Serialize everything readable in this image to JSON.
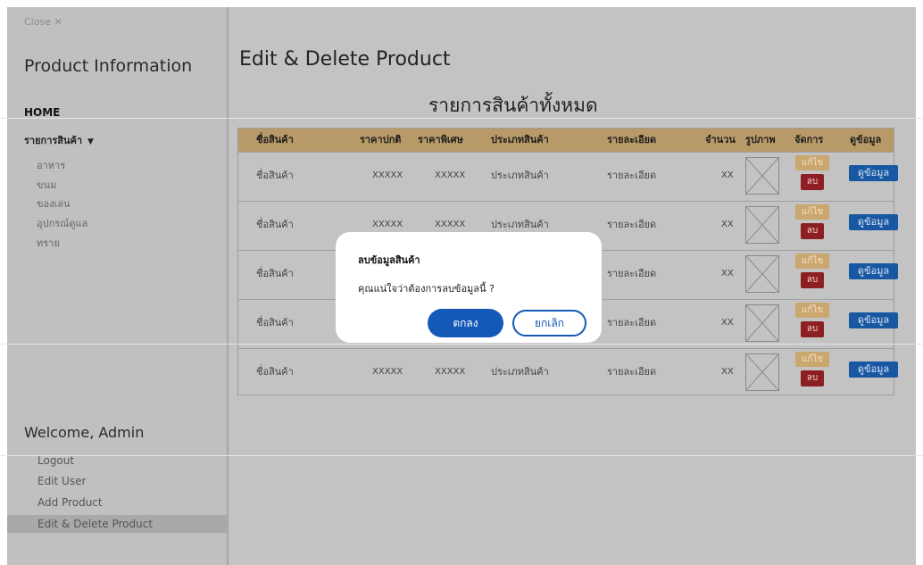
{
  "sidebar": {
    "close_label": "Close ✕",
    "title": "Product Information",
    "home_label": "HOME",
    "category_menu_label": "รายการสินค้า",
    "category_items": [
      "อาหาร",
      "ขนม",
      "ของเล่น",
      "อุปกรณ์ดูแล",
      "ทราย"
    ],
    "welcome": "Welcome, Admin",
    "bottom_items": [
      "Logout",
      "Edit User",
      "Add Product",
      "Edit & Delete Product"
    ],
    "active_item": "Edit & Delete Product"
  },
  "main": {
    "page_title": "Edit & Delete Product",
    "list_title": "รายการสินค้าทั้งหมด"
  },
  "table": {
    "headers": {
      "name": "ชื่อสินค้า",
      "price": "ราคาปกติ",
      "special": "ราคาพิเศษ",
      "type": "ประเภทสินค้า",
      "detail": "รายละเอียด",
      "qty": "จำนวน",
      "image": "รูปภาพ",
      "manage": "จัดการ",
      "view": "ดูข้อมูล"
    },
    "rows": [
      {
        "name": "ชื่อสินค้า",
        "price": "XXXXX",
        "special": "XXXXX",
        "type": "ประเภทสินค้า",
        "detail": "รายละเอียด",
        "qty": "XX",
        "edit": "แก้ไข",
        "delete": "ลบ",
        "view": "ดูข้อมูล"
      },
      {
        "name": "ชื่อสินค้า",
        "price": "XXXXX",
        "special": "XXXXX",
        "type": "ประเภทสินค้า",
        "detail": "รายละเอียด",
        "qty": "XX",
        "edit": "แก้ไข",
        "delete": "ลบ",
        "view": "ดูข้อมูล"
      },
      {
        "name": "ชื่อสินค้า",
        "price": "",
        "special": "",
        "type": "",
        "detail": "รายละเอียด",
        "qty": "XX",
        "edit": "แก้ไข",
        "delete": "ลบ",
        "view": "ดูข้อมูล"
      },
      {
        "name": "ชื่อสินค้า",
        "price": "",
        "special": "",
        "type": "",
        "detail": "รายละเอียด",
        "qty": "XX",
        "edit": "แก้ไข",
        "delete": "ลบ",
        "view": "ดูข้อมูล"
      },
      {
        "name": "ชื่อสินค้า",
        "price": "XXXXX",
        "special": "XXXXX",
        "type": "ประเภทสินค้า",
        "detail": "รายละเอียด",
        "qty": "XX",
        "edit": "แก้ไข",
        "delete": "ลบ",
        "view": "ดูข้อมูล"
      }
    ]
  },
  "modal": {
    "title": "ลบข้อมูลสินค้า",
    "message": "คุณแน่ใจว่าต้องการลบข้อมูลนี้ ?",
    "confirm_label": "ตกลง",
    "cancel_label": "ยกเลิก"
  },
  "colors": {
    "header_bg": "#b89a68",
    "edit_button": "#caa76e",
    "delete_button": "#8d1f23",
    "view_button": "#1857a2",
    "confirm_button": "#1458b8",
    "overlay": "#c3c3c3"
  }
}
